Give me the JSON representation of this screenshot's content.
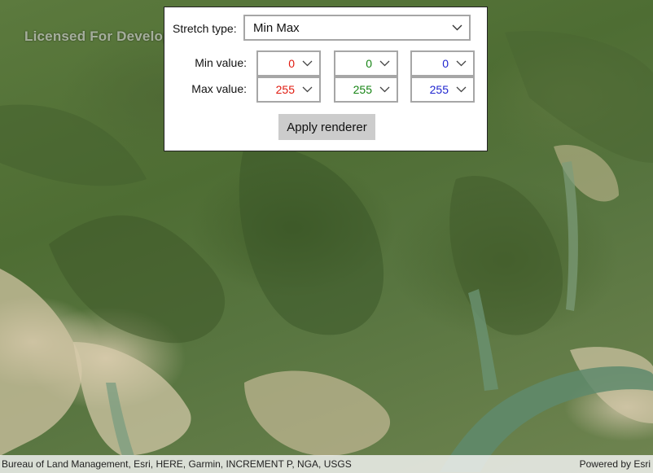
{
  "map": {
    "watermark": "Licensed For Developer Use Only",
    "attribution": "Bureau of Land Management, Esri, HERE, Garmin, INCREMENT P, NGA, USGS",
    "powered_by": "Powered by Esri"
  },
  "panel": {
    "stretch_type_label": "Stretch type:",
    "stretch_type_value": "Min Max",
    "min_label": "Min value:",
    "max_label": "Max value:",
    "min_values": {
      "red": "0",
      "green": "0",
      "blue": "0"
    },
    "max_values": {
      "red": "255",
      "green": "255",
      "blue": "255"
    },
    "apply_label": "Apply renderer"
  },
  "colors": {
    "red_text": "#e0190e",
    "green_text": "#168414",
    "blue_text": "#1f25cf",
    "apply_button_bg": "#cccccc"
  },
  "icons": {
    "dropdown": "chevron-down-icon"
  }
}
